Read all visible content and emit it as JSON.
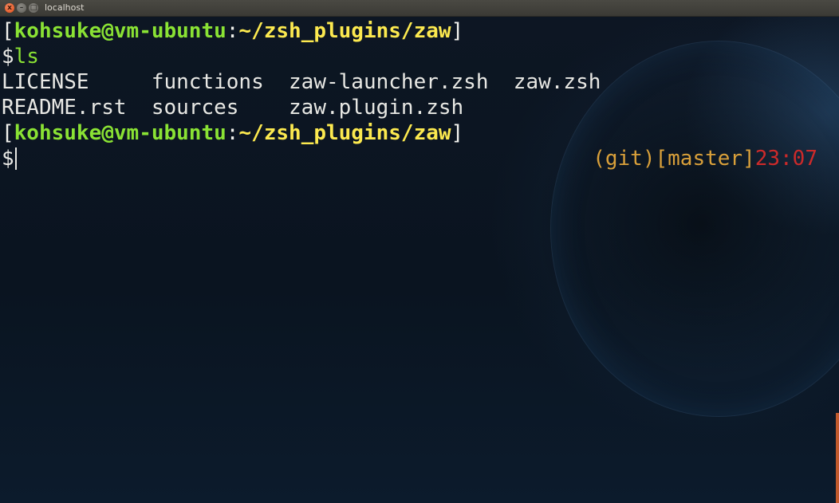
{
  "window": {
    "title": "localhost",
    "buttons": {
      "close": "x",
      "minimize": "–",
      "maximize": "□"
    }
  },
  "terminal": {
    "prompt1": {
      "open_bracket": "[",
      "user_host": "kohsuke@vm-ubuntu",
      "colon": ":",
      "path": "~/zsh_plugins/zaw",
      "close_bracket": "]"
    },
    "command_line": {
      "symbol": "$",
      "command": "ls"
    },
    "ls_output": [
      {
        "c1": "LICENSE     ",
        "c2": "functions  ",
        "c3": "zaw-launcher.zsh  ",
        "c4": "zaw.zsh"
      },
      {
        "c1": "README.rst  ",
        "c2": "sources    ",
        "c3": "zaw.plugin.zsh",
        "c4": ""
      }
    ],
    "prompt2": {
      "open_bracket": "[",
      "user_host": "kohsuke@vm-ubuntu",
      "colon": ":",
      "path": "~/zsh_plugins/zaw",
      "close_bracket": "]"
    },
    "current_line": {
      "symbol": "$"
    },
    "right_prompt": {
      "vcs": "(git)",
      "branch": "[master]",
      "time": "23:07"
    }
  },
  "colors": {
    "user_host": "#8ae234",
    "path": "#fce94f",
    "git": "#d9a03a",
    "time": "#cc2a2a",
    "text": "#e8e8e4",
    "background": "#0b1320"
  }
}
